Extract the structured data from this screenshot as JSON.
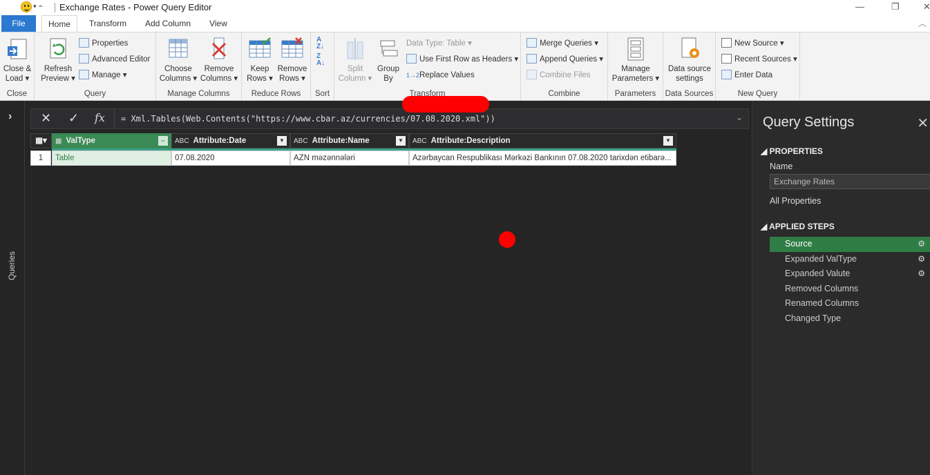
{
  "window": {
    "title": "Exchange Rates - Power Query Editor"
  },
  "tabs": [
    {
      "label": "File"
    },
    {
      "label": "Home"
    },
    {
      "label": "Transform"
    },
    {
      "label": "Add Column"
    },
    {
      "label": "View"
    }
  ],
  "ribbon": {
    "close": {
      "close_load": "Close &",
      "close_load2": "Load ▾",
      "group": "Close"
    },
    "query": {
      "refresh": "Refresh",
      "refresh2": "Preview ▾",
      "properties": "Properties",
      "advanced_editor": "Advanced Editor",
      "manage": "Manage ▾",
      "group": "Query"
    },
    "manage_columns": {
      "choose": "Choose",
      "choose2": "Columns ▾",
      "remove": "Remove",
      "remove2": "Columns ▾",
      "group": "Manage Columns"
    },
    "reduce_rows": {
      "keep": "Keep",
      "keep2": "Rows ▾",
      "remove": "Remove",
      "remove2": "Rows ▾",
      "group": "Reduce Rows"
    },
    "sort": {
      "group": "Sort"
    },
    "transform": {
      "split": "Split",
      "split2": "Column ▾",
      "group_by": "Group",
      "group_by2": "By",
      "data_type": "Data Type: Table ▾",
      "first_row": "Use First Row as Headers ▾",
      "replace": "Replace Values",
      "group": "Transform"
    },
    "combine": {
      "merge": "Merge Queries ▾",
      "append": "Append Queries ▾",
      "combine_files": "Combine Files",
      "group": "Combine"
    },
    "parameters": {
      "manage": "Manage",
      "manage2": "Parameters ▾",
      "group": "Parameters"
    },
    "data_sources": {
      "settings": "Data source",
      "settings2": "settings",
      "group": "Data Sources"
    },
    "new_query": {
      "new_source": "New Source ▾",
      "recent": "Recent Sources ▾",
      "enter": "Enter Data",
      "group": "New Query"
    }
  },
  "left_pane": {
    "label": "Queries"
  },
  "formula": {
    "text": "= Xml.Tables(Web.Contents(\"https://www.cbar.az/currencies/07.08.2020.xml\"))"
  },
  "grid": {
    "columns": [
      {
        "type": "",
        "name": "ValType"
      },
      {
        "type": "ABC",
        "name": "Attribute:Date"
      },
      {
        "type": "ABC",
        "name": "Attribute:Name"
      },
      {
        "type": "ABC",
        "name": "Attribute:Description"
      }
    ],
    "rows": [
      {
        "num": "1",
        "cells": [
          "Table",
          "07.08.2020",
          "AZN məzənnələri",
          "Azərbaycan Respublikası Mərkəzi Bankının 07.08.2020 tarixdən etibarə..."
        ]
      }
    ]
  },
  "query_settings": {
    "title": "Query Settings",
    "properties_header": "PROPERTIES",
    "name_label": "Name",
    "name_value": "Exchange Rates",
    "all_properties": "All Properties",
    "steps_header": "APPLIED STEPS",
    "steps": [
      "Source",
      "Expanded ValType",
      "Expanded Valute",
      "Removed Columns",
      "Renamed Columns",
      "Changed Type"
    ]
  }
}
